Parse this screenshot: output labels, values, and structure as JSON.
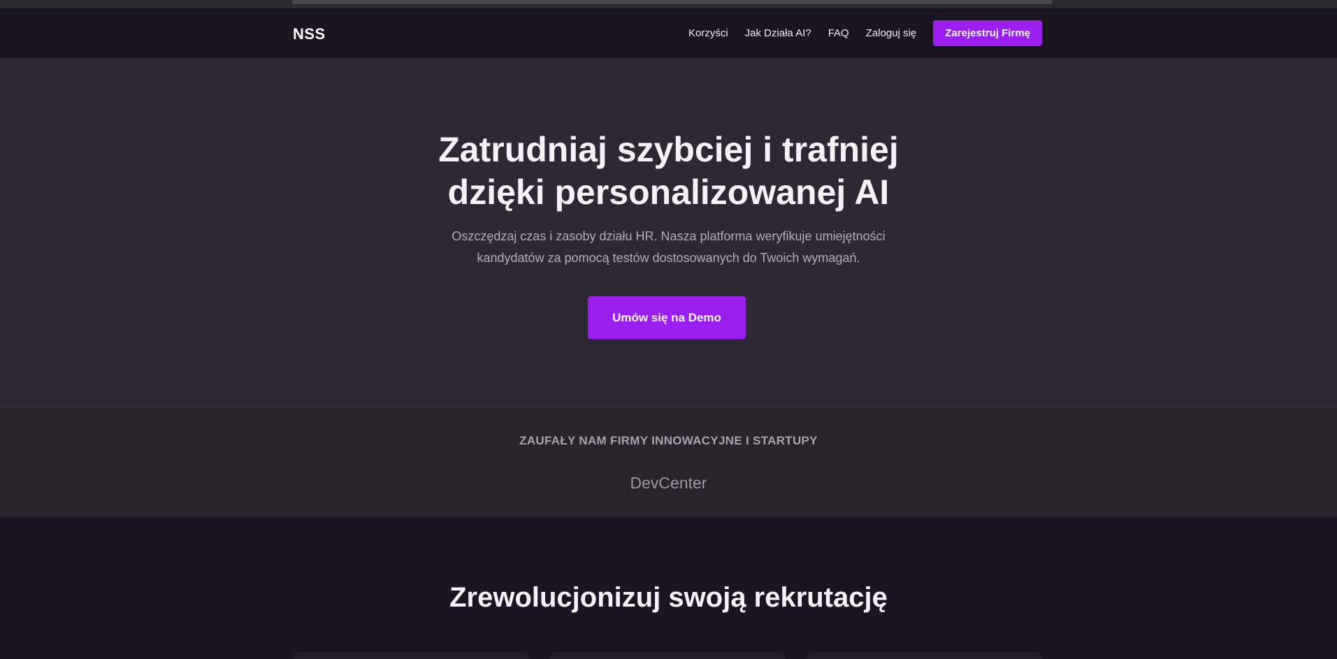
{
  "navbar": {
    "logo": "NSS",
    "links": [
      "Korzyści",
      "Jak Działa AI?",
      "FAQ",
      "Zaloguj się"
    ],
    "cta": "Zarejestruj Firmę"
  },
  "hero": {
    "title_line1": "Zatrudniaj szybciej i trafniej",
    "title_line2": "dzięki personalizowanej AI",
    "subtitle_line1": "Oszczędzaj czas i zasoby działu HR. Nasza platforma weryfikuje umiejętności",
    "subtitle_line2": "kandydatów za pomocą testów dostosowanych do Twoich wymagań.",
    "cta": "Umów się na Demo"
  },
  "trusted": {
    "title": "ZAUFAŁY NAM FIRMY INNOWACYJNE I STARTUPY",
    "logos": [
      "DevCenter"
    ]
  },
  "features": {
    "title": "Zrewolucjonizuj swoją rekrutację"
  },
  "colors": {
    "accent": "#9a1ff0",
    "nav_bg": "#1a1420",
    "hero_bg": "#2d2834",
    "trusted_bg": "#28242c",
    "page_bg": "#1c1422"
  }
}
